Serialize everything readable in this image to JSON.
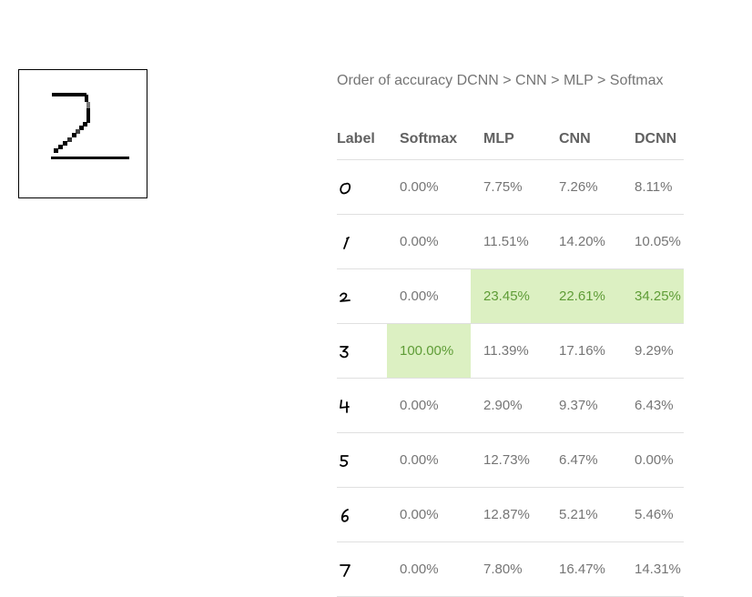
{
  "drawing": {
    "digit_icon": "handwritten-digit-2-drawing"
  },
  "caption": "Order of accuracy DCNN > CNN > MLP > Softmax",
  "table": {
    "headers": [
      "Label",
      "Softmax",
      "MLP",
      "CNN",
      "DCNN"
    ],
    "highlight_color": "#dcf0c2",
    "highlight_text_color": "#5e9c36",
    "rows": [
      {
        "label": "0",
        "softmax": "0.00%",
        "mlp": "7.75%",
        "cnn": "7.26%",
        "dcnn": "8.11%"
      },
      {
        "label": "1",
        "softmax": "0.00%",
        "mlp": "11.51%",
        "cnn": "14.20%",
        "dcnn": "10.05%"
      },
      {
        "label": "2",
        "softmax": "0.00%",
        "mlp": "23.45%",
        "cnn": "22.61%",
        "dcnn": "34.25%"
      },
      {
        "label": "3",
        "softmax": "100.00%",
        "mlp": "11.39%",
        "cnn": "17.16%",
        "dcnn": "9.29%"
      },
      {
        "label": "4",
        "softmax": "0.00%",
        "mlp": "2.90%",
        "cnn": "9.37%",
        "dcnn": "6.43%"
      },
      {
        "label": "5",
        "softmax": "0.00%",
        "mlp": "12.73%",
        "cnn": "6.47%",
        "dcnn": "0.00%"
      },
      {
        "label": "6",
        "softmax": "0.00%",
        "mlp": "12.87%",
        "cnn": "5.21%",
        "dcnn": "5.46%"
      },
      {
        "label": "7",
        "softmax": "0.00%",
        "mlp": "7.80%",
        "cnn": "16.47%",
        "dcnn": "14.31%"
      }
    ]
  }
}
